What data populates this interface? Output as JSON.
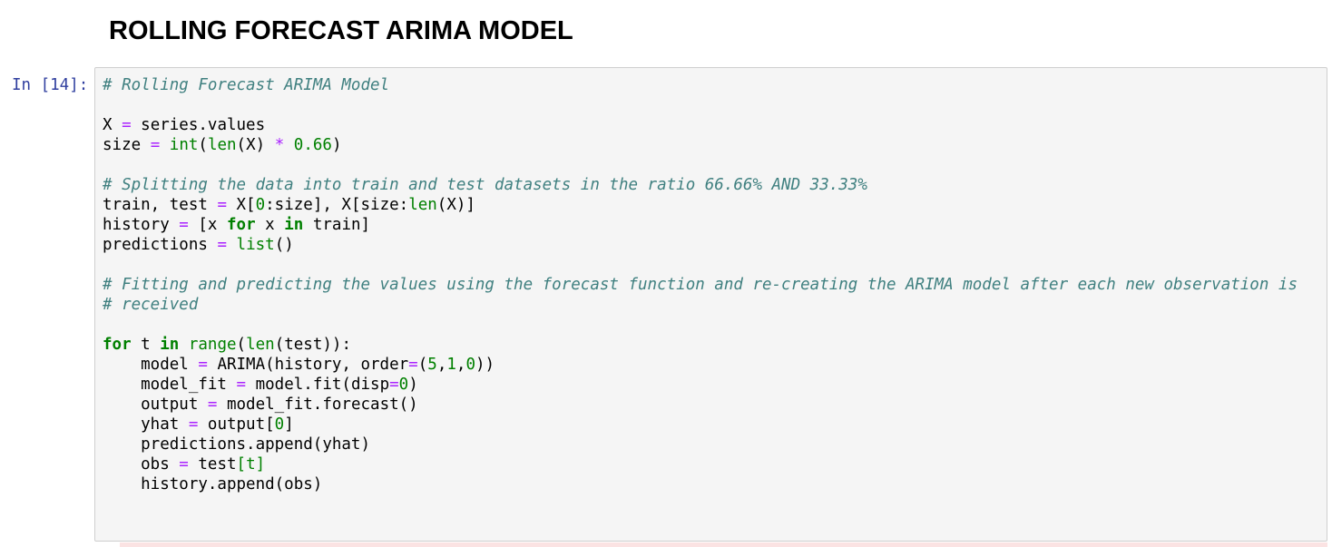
{
  "heading": "ROLLING FORECAST ARIMA MODEL",
  "cell": {
    "prompt": "In [14]:",
    "lines": [
      [
        {
          "t": "# Rolling Forecast ARIMA Model",
          "c": "cm"
        }
      ],
      [],
      [
        {
          "t": "X "
        },
        {
          "t": "=",
          "c": "op"
        },
        {
          "t": " series.values"
        }
      ],
      [
        {
          "t": "size "
        },
        {
          "t": "=",
          "c": "op"
        },
        {
          "t": " "
        },
        {
          "t": "int",
          "c": "bi"
        },
        {
          "t": "("
        },
        {
          "t": "len",
          "c": "bi"
        },
        {
          "t": "(X) "
        },
        {
          "t": "*",
          "c": "op"
        },
        {
          "t": " "
        },
        {
          "t": "0.66",
          "c": "nm"
        },
        {
          "t": ")"
        }
      ],
      [],
      [
        {
          "t": "# Splitting the data into train and test datasets in the ratio 66.66% AND 33.33%",
          "c": "cm"
        }
      ],
      [
        {
          "t": "train, test "
        },
        {
          "t": "=",
          "c": "op"
        },
        {
          "t": " X["
        },
        {
          "t": "0",
          "c": "nm"
        },
        {
          "t": ":size], X[size:"
        },
        {
          "t": "len",
          "c": "bi"
        },
        {
          "t": "(X)]"
        }
      ],
      [
        {
          "t": "history "
        },
        {
          "t": "=",
          "c": "op"
        },
        {
          "t": " [x "
        },
        {
          "t": "for",
          "c": "kw"
        },
        {
          "t": " x "
        },
        {
          "t": "in",
          "c": "kw"
        },
        {
          "t": " train]"
        }
      ],
      [
        {
          "t": "predictions "
        },
        {
          "t": "=",
          "c": "op"
        },
        {
          "t": " "
        },
        {
          "t": "list",
          "c": "bi"
        },
        {
          "t": "()"
        }
      ],
      [],
      [
        {
          "t": "# Fitting and predicting the values using the forecast function and re-creating the ARIMA model after each new observation is",
          "c": "cm"
        }
      ],
      [
        {
          "t": "# received",
          "c": "cm"
        }
      ],
      [],
      [
        {
          "t": "for",
          "c": "kw"
        },
        {
          "t": " t "
        },
        {
          "t": "in",
          "c": "kw"
        },
        {
          "t": " "
        },
        {
          "t": "range",
          "c": "bi"
        },
        {
          "t": "("
        },
        {
          "t": "len",
          "c": "bi"
        },
        {
          "t": "(test)):"
        }
      ],
      [
        {
          "t": "    model "
        },
        {
          "t": "=",
          "c": "op"
        },
        {
          "t": " ARIMA(history, order"
        },
        {
          "t": "=",
          "c": "op"
        },
        {
          "t": "("
        },
        {
          "t": "5",
          "c": "nm"
        },
        {
          "t": ","
        },
        {
          "t": "1",
          "c": "nm"
        },
        {
          "t": ","
        },
        {
          "t": "0",
          "c": "nm"
        },
        {
          "t": "))"
        }
      ],
      [
        {
          "t": "    model_fit "
        },
        {
          "t": "=",
          "c": "op"
        },
        {
          "t": " model.fit(disp"
        },
        {
          "t": "=",
          "c": "op"
        },
        {
          "t": "0",
          "c": "nm"
        },
        {
          "t": ")"
        }
      ],
      [
        {
          "t": "    output "
        },
        {
          "t": "=",
          "c": "op"
        },
        {
          "t": " model_fit.forecast()"
        }
      ],
      [
        {
          "t": "    yhat "
        },
        {
          "t": "=",
          "c": "op"
        },
        {
          "t": " output["
        },
        {
          "t": "0",
          "c": "nm"
        },
        {
          "t": "]"
        }
      ],
      [
        {
          "t": "    predictions.append(yhat)"
        }
      ],
      [
        {
          "t": "    obs "
        },
        {
          "t": "=",
          "c": "op"
        },
        {
          "t": " test"
        },
        {
          "t": "[t]",
          "c": "nm"
        }
      ],
      [
        {
          "t": "    history.append(obs)"
        }
      ]
    ]
  }
}
